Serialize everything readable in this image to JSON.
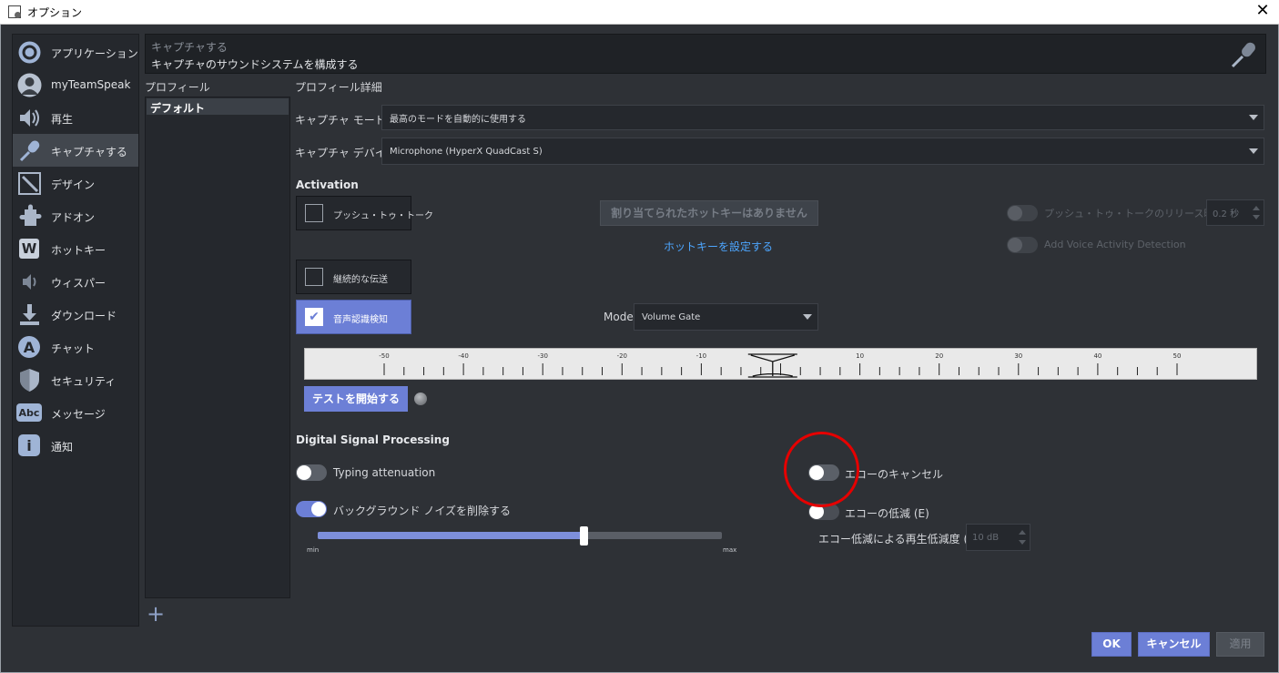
{
  "window": {
    "title": "オプション",
    "close_glyph": "✕"
  },
  "sidebar": {
    "items": [
      {
        "label": "アプリケーション",
        "icon": "teamspeak-logo-icon"
      },
      {
        "label": "myTeamSpeak",
        "icon": "user-avatar-icon"
      },
      {
        "label": "再生",
        "icon": "speaker-icon"
      },
      {
        "label": "キャプチャする",
        "icon": "microphone-icon",
        "active": true
      },
      {
        "label": "デザイン",
        "icon": "design-icon"
      },
      {
        "label": "アドオン",
        "icon": "puzzle-icon"
      },
      {
        "label": "ホットキー",
        "icon": "keyboard-w-icon",
        "glyph": "W"
      },
      {
        "label": "ウィスパー",
        "icon": "whisper-icon"
      },
      {
        "label": "ダウンロード",
        "icon": "download-icon"
      },
      {
        "label": "チャット",
        "icon": "chat-a-icon",
        "glyph": "A"
      },
      {
        "label": "セキュリティ",
        "icon": "shield-icon"
      },
      {
        "label": "メッセージ",
        "icon": "message-abc-icon",
        "glyph": "Abc"
      },
      {
        "label": "通知",
        "icon": "info-icon",
        "glyph": "i"
      }
    ]
  },
  "header": {
    "title": "キャプチャする",
    "subtitle": "キャプチャのサウンドシステムを構成する",
    "icon": "microphone-icon"
  },
  "profiles": {
    "label": "プロフィール",
    "items": [
      "デフォルト"
    ],
    "add_glyph": "+"
  },
  "details": {
    "label": "プロフィール詳細",
    "capture_mode": {
      "label": "キャプチャ モード:",
      "value": "最高のモードを自動的に使用する"
    },
    "capture_device": {
      "label": "キャプチャ デバイス:",
      "value": "Microphone (HyperX QuadCast S)"
    }
  },
  "activation": {
    "title": "Activation",
    "push_to_talk": {
      "label": "プッシュ・トゥ・トーク",
      "checked": false
    },
    "hotkey_button": "割り当てられたホットキーはありません",
    "set_hotkey_link": "ホットキーを設定する",
    "ptt_release_delay": {
      "label": "プッシュ・トゥ・トークのリリース時の遅延",
      "value": "0.2 秒"
    },
    "add_vad": {
      "label": "Add Voice Activity Detection"
    },
    "continuous": {
      "label": "継続的な伝送",
      "checked": false
    },
    "voice_detection": {
      "label": "音声認識検知",
      "checked": true,
      "check_glyph": "✔"
    },
    "mode": {
      "label": "Mode",
      "value": "Volume Gate"
    }
  },
  "scale": {
    "ticks": [
      "-50",
      "-40",
      "-30",
      "-20",
      "-10",
      "10",
      "20",
      "30",
      "40",
      "50"
    ],
    "gate_value": -1
  },
  "test_button": "テストを開始する",
  "dsp": {
    "title": "Digital Signal Processing",
    "typing_attenuation": {
      "label": "Typing attenuation",
      "on": false
    },
    "noise_removal": {
      "label": "バックグラウンド ノイズを削除する",
      "on": true
    },
    "noise_level": {
      "value": 0.66,
      "min_label": "min",
      "max_label": "max"
    },
    "echo_cancel": {
      "label": "エコーのキャンセル",
      "on": false
    },
    "echo_reduction": {
      "label": "エコーの低減 (E)",
      "on": false
    },
    "echo_reduction_level": {
      "label": "エコー低減による再生低減度 (r):",
      "value": "10 dB"
    }
  },
  "buttons": {
    "ok": "OK",
    "cancel": "キャンセル",
    "apply": "適用"
  },
  "colors": {
    "accent": "#6c7fd6",
    "annotation": "#e50000",
    "link": "#4da6ff"
  }
}
